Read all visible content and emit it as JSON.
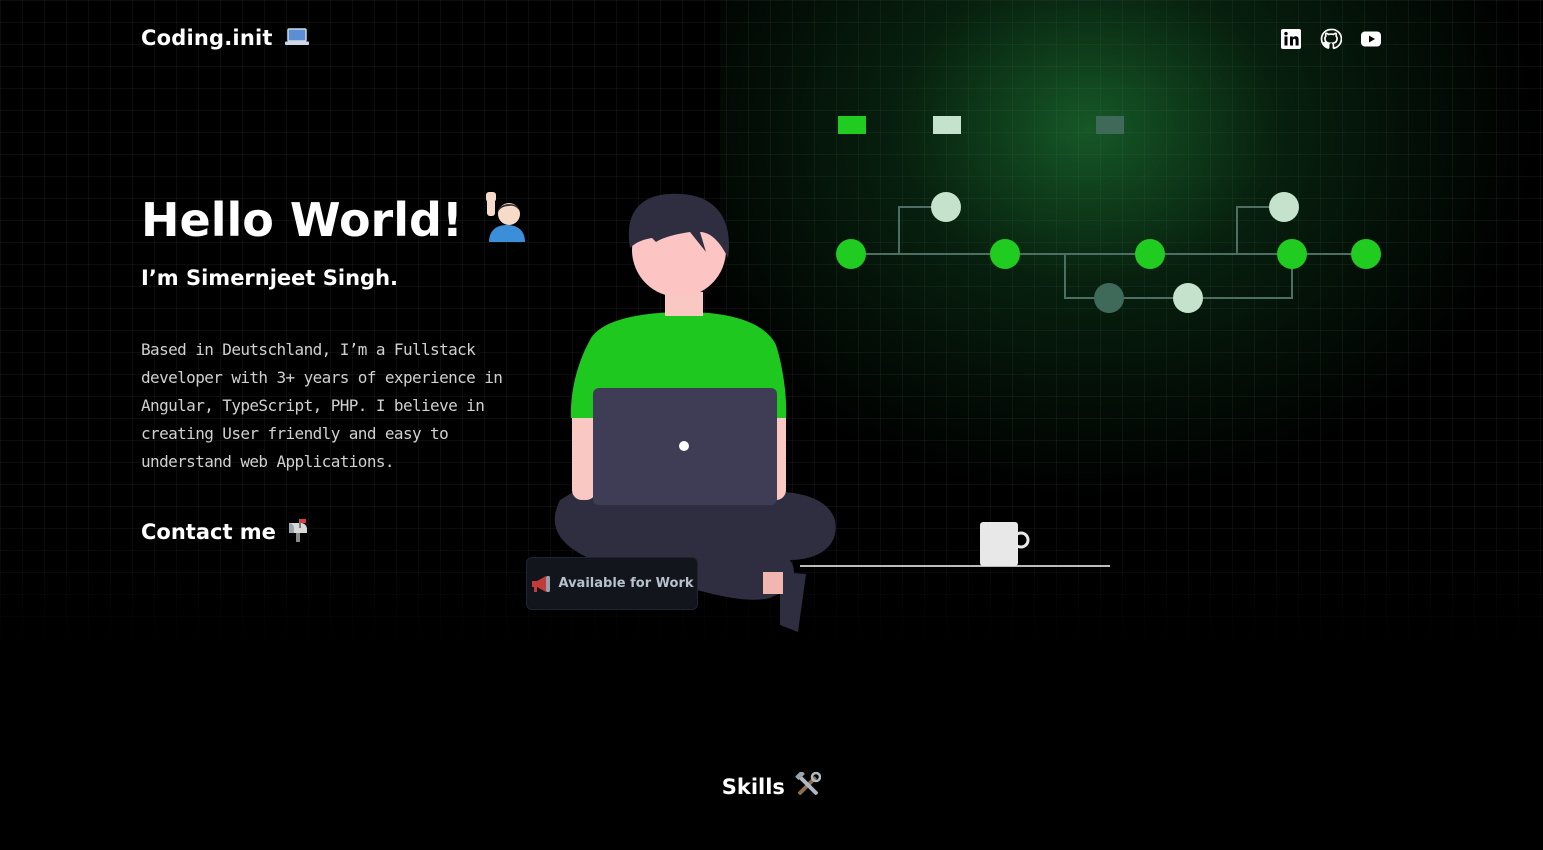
{
  "header": {
    "logo_text": "Coding.init",
    "logo_icon": "laptop-emoji",
    "social": [
      {
        "name": "linkedin-icon"
      },
      {
        "name": "github-icon"
      },
      {
        "name": "youtube-icon"
      }
    ]
  },
  "hero": {
    "title": "Hello World!",
    "title_icon": "raising-hand-emoji",
    "subtitle": "I’m Simernjeet Singh.",
    "description": "Based in Deutschland, I’m a Fullstack developer with 3+ years of experience in Angular, TypeScript, PHP. I believe in creating User friendly and easy to understand web Applications.",
    "contact_label": "Contact me",
    "contact_icon": "mailbox-emoji"
  },
  "badge": {
    "label": "Available for Work",
    "icon": "megaphone-emoji"
  },
  "skills": {
    "title": "Skills",
    "icon": "tools-emoji"
  },
  "colors": {
    "background": "#000000",
    "accent_green": "#1fcc1f",
    "node_light": "#c5e2cc",
    "node_dark": "#3f6a5a",
    "glow": "#1f7a3a",
    "laptop": "#3f3d56"
  }
}
